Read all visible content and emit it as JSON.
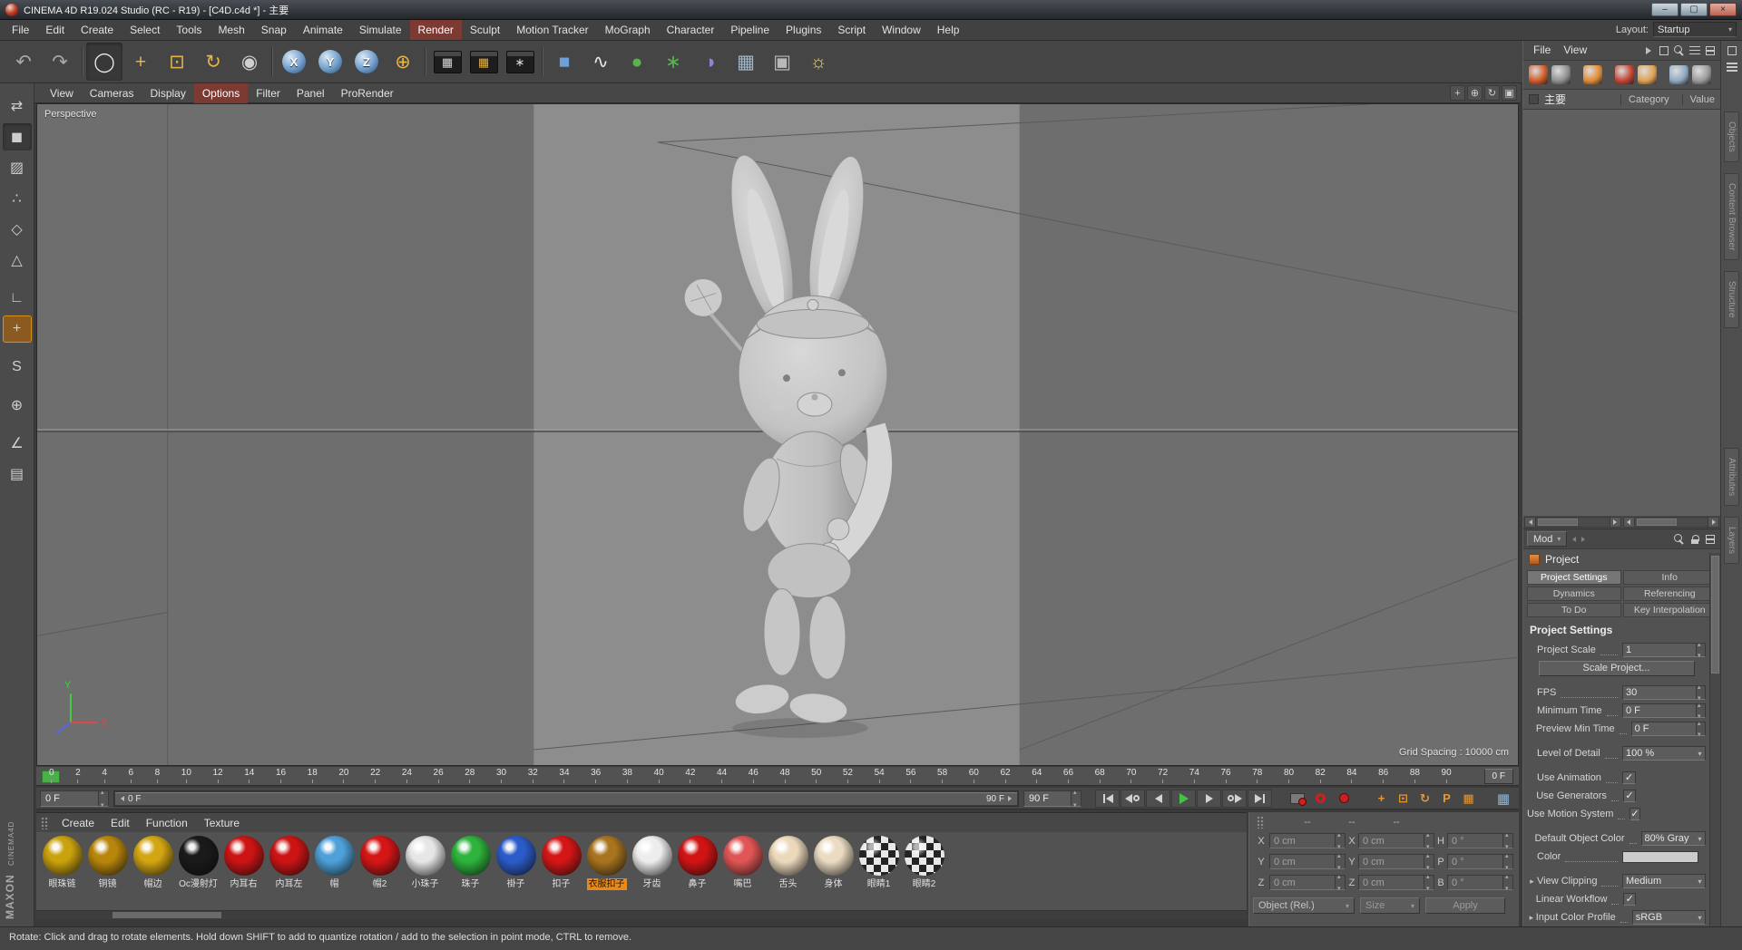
{
  "window": {
    "title": "CINEMA 4D R19.024 Studio (RC - R19) - [C4D.c4d *] - 主要",
    "controls": {
      "minimize": "–",
      "maximize": "▢",
      "close": "×"
    }
  },
  "menu_bar": {
    "items": [
      {
        "label": "File"
      },
      {
        "label": "Edit"
      },
      {
        "label": "Create"
      },
      {
        "label": "Select"
      },
      {
        "label": "Tools"
      },
      {
        "label": "Mesh"
      },
      {
        "label": "Snap"
      },
      {
        "label": "Animate"
      },
      {
        "label": "Simulate"
      },
      {
        "label": "Render",
        "active": true
      },
      {
        "label": "Sculpt"
      },
      {
        "label": "Motion Tracker"
      },
      {
        "label": "MoGraph"
      },
      {
        "label": "Character"
      },
      {
        "label": "Pipeline"
      },
      {
        "label": "Plugins"
      },
      {
        "label": "Script"
      },
      {
        "label": "Window"
      },
      {
        "label": "Help"
      }
    ],
    "layout_label": "Layout:",
    "layout_value": "Startup"
  },
  "toolbar": {
    "buttons": [
      {
        "name": "undo-button",
        "glyph": "↶",
        "color": "#a8a8a8"
      },
      {
        "name": "redo-button",
        "glyph": "↷",
        "color": "#a8a8a8"
      },
      {
        "name": "toolbar-separator",
        "sep": true
      },
      {
        "name": "live-selection-tool",
        "glyph": "◯",
        "color": "#e8e8e8",
        "pressed": true
      },
      {
        "name": "move-tool",
        "glyph": "+",
        "color": "#e3b34c"
      },
      {
        "name": "scale-tool",
        "glyph": "⊡",
        "color": "#e3b34c"
      },
      {
        "name": "rotate-tool",
        "glyph": "↻",
        "color": "#e3b34c"
      },
      {
        "name": "last-used-tool",
        "glyph": "◉",
        "color": "#cfcfcf"
      },
      {
        "name": "toolbar-separator",
        "sep": true
      },
      {
        "name": "x-axis-lock",
        "glyph": "X",
        "color": "#ffffff",
        "round": true
      },
      {
        "name": "y-axis-lock",
        "glyph": "Y",
        "color": "#ffffff",
        "round": true
      },
      {
        "name": "z-axis-lock",
        "glyph": "Z",
        "color": "#ffffff",
        "round": true
      },
      {
        "name": "coordinate-system-toggle",
        "glyph": "⊕",
        "color": "#e3b34c"
      },
      {
        "name": "toolbar-separator",
        "sep": true
      },
      {
        "name": "render-view-button",
        "glyph": "▦",
        "color": "#d8d8d8",
        "dark": true
      },
      {
        "name": "render-picture-viewer-button",
        "glyph": "▦",
        "color": "#e3b34c",
        "dark": true
      },
      {
        "name": "render-settings-button",
        "glyph": "∗",
        "color": "#d8d8d8",
        "dark": true
      },
      {
        "name": "toolbar-separator",
        "sep": true
      },
      {
        "name": "add-primitive-button",
        "glyph": "■",
        "color": "#6f9fd8"
      },
      {
        "name": "add-spline-button",
        "glyph": "∿",
        "color": "#e8e8e8"
      },
      {
        "name": "add-subdivision-surface-button",
        "glyph": "●",
        "color": "#58b34e"
      },
      {
        "name": "add-generator-button",
        "glyph": "∗",
        "color": "#58b34e"
      },
      {
        "name": "add-deformer-button",
        "glyph": "◑",
        "color": "#8f86d8"
      },
      {
        "name": "add-environment-button",
        "glyph": "▦",
        "color": "#9fb6c8"
      },
      {
        "name": "add-camera-button",
        "glyph": "▣",
        "color": "#b8b8b8"
      },
      {
        "name": "add-light-button",
        "glyph": "☼",
        "color": "#e8d87a"
      }
    ]
  },
  "left_toolbar": {
    "buttons": [
      {
        "name": "make-editable-button",
        "glyph": "⇄"
      },
      {
        "name": "model-mode-button",
        "glyph": "◼",
        "pressed": true
      },
      {
        "name": "texture-mode-button",
        "glyph": "▨"
      },
      {
        "name": "points-mode-button",
        "glyph": "∴"
      },
      {
        "name": "edges-mode-button",
        "glyph": "◇"
      },
      {
        "name": "polygons-mode-button",
        "glyph": "△"
      },
      {
        "name": "workplane-mode-button",
        "glyph": "∟",
        "gap": true
      },
      {
        "name": "enable-axis-button",
        "glyph": "+",
        "active": true
      },
      {
        "name": "viewport-solo-button",
        "glyph": "S",
        "gap": true
      },
      {
        "name": "snap-toggle-button",
        "glyph": "⊕",
        "gap": true
      },
      {
        "name": "quantize-button",
        "glyph": "∠",
        "gap": true
      },
      {
        "name": "workplane-lock-button",
        "glyph": "▤"
      }
    ]
  },
  "viewport": {
    "menu": [
      {
        "label": "View"
      },
      {
        "label": "Cameras"
      },
      {
        "label": "Display"
      },
      {
        "label": "Options",
        "active": true
      },
      {
        "label": "Filter"
      },
      {
        "label": "Panel"
      },
      {
        "label": "ProRender"
      }
    ],
    "nav_icons": [
      {
        "name": "pan-view-icon",
        "glyph": "+"
      },
      {
        "name": "zoom-view-icon",
        "glyph": "⊕"
      },
      {
        "name": "rotate-view-icon",
        "glyph": "↻"
      },
      {
        "name": "toggle-panels-icon",
        "glyph": "▣"
      }
    ],
    "camera_label": "Perspective",
    "grid_spacing": "Grid Spacing : 10000 cm",
    "axis_x": "X",
    "axis_y": "Y"
  },
  "timeline": {
    "ticks": [
      0,
      2,
      4,
      6,
      8,
      10,
      12,
      14,
      16,
      18,
      20,
      22,
      24,
      26,
      28,
      30,
      32,
      34,
      36,
      38,
      40,
      42,
      44,
      46,
      48,
      50,
      52,
      54,
      56,
      58,
      60,
      62,
      64,
      66,
      68,
      70,
      72,
      74,
      76,
      78,
      80,
      82,
      84,
      86,
      88,
      90
    ],
    "current_frame": "0 F",
    "frame_field": "0 F",
    "range_start": "0 F",
    "range_end": "90 F",
    "end_field": "90 F",
    "window_icon": "▦",
    "toggles": [
      {
        "name": "record-position-toggle",
        "glyph": "+"
      },
      {
        "name": "record-scale-toggle",
        "glyph": "⊡"
      },
      {
        "name": "record-rotation-toggle",
        "glyph": "↻"
      },
      {
        "name": "record-parameter-toggle",
        "glyph": "P"
      },
      {
        "name": "record-pla-toggle",
        "glyph": "▦"
      }
    ]
  },
  "materials": {
    "menus": [
      {
        "label": "Create"
      },
      {
        "label": "Edit"
      },
      {
        "label": "Function"
      },
      {
        "label": "Texture"
      }
    ],
    "items": [
      {
        "label": "眼珠链",
        "color": "#caa20e"
      },
      {
        "label": "铜镜",
        "color": "#b8860b"
      },
      {
        "label": "帽边",
        "color": "#d2a612"
      },
      {
        "label": "Oc漫射灯",
        "color": "#1a1a1a"
      },
      {
        "label": "内耳右",
        "color": "#cc1414"
      },
      {
        "label": "内耳左",
        "color": "#cc1414"
      },
      {
        "label": "帽",
        "color": "#4da0d8"
      },
      {
        "label": "帽2",
        "color": "#d41616"
      },
      {
        "label": "小珠子",
        "color": "#e6e6e6"
      },
      {
        "label": "珠子",
        "color": "#2eb33c"
      },
      {
        "label": "褂子",
        "color": "#2b5bc8"
      },
      {
        "label": "扣子",
        "color": "#d41616"
      },
      {
        "label": "衣服扣子",
        "color": "#a9741f",
        "selected": true
      },
      {
        "label": "牙齿",
        "color": "#ededed"
      },
      {
        "label": "鼻子",
        "color": "#d01414"
      },
      {
        "label": "嘴巴",
        "color": "#e05555"
      },
      {
        "label": "舌头",
        "color": "#ecd9bc"
      },
      {
        "label": "身体",
        "color": "#eadbc2"
      },
      {
        "label": "眼睛1",
        "color": "#cccccc",
        "checker": true
      },
      {
        "label": "眼睛2",
        "color": "#cccccc",
        "checker": true
      }
    ]
  },
  "coordinates": {
    "headers": [
      "--",
      "--",
      "--"
    ],
    "rows": [
      {
        "pl": "X",
        "pv": "0 cm",
        "sl": "X",
        "sv": "0 cm",
        "rl": "H",
        "rv": "0 °"
      },
      {
        "pl": "Y",
        "pv": "0 cm",
        "sl": "Y",
        "sv": "0 cm",
        "rl": "P",
        "rv": "0 °"
      },
      {
        "pl": "Z",
        "pv": "0 cm",
        "sl": "Z",
        "sv": "0 cm",
        "rl": "B",
        "rv": "0 °"
      }
    ],
    "mode": "Object (Rel.)",
    "size_mode": "Size",
    "apply_label": "Apply"
  },
  "take_panel": {
    "menus": [
      {
        "label": "File"
      },
      {
        "label": "View"
      }
    ],
    "icons": [
      {
        "name": "take-record-icon",
        "c": "#d05a28"
      },
      {
        "name": "take-lock-icon",
        "c": "#8f8f8f"
      },
      {
        "name": "auto-take-icon",
        "c": "#e08a30",
        "gap": true
      },
      {
        "name": "new-take-icon",
        "c": "#c24432",
        "gap": true
      },
      {
        "name": "take-category-icon",
        "c": "#e0a050"
      },
      {
        "name": "take-display-icon",
        "c": "#90a8c0",
        "gap": true
      },
      {
        "name": "take-overrides-icon",
        "c": "#9a9a9a"
      }
    ],
    "main_take": "主要",
    "columns": [
      "Category",
      "Value"
    ]
  },
  "attributes": {
    "mode_label": "Mod",
    "object_label": "Project",
    "tabs": [
      {
        "label": "Project Settings",
        "active": true
      },
      {
        "label": "Info"
      },
      {
        "label": "Dynamics"
      },
      {
        "label": "Referencing"
      },
      {
        "label": "To Do"
      },
      {
        "label": "Key Interpolation"
      }
    ],
    "section_title": "Project Settings",
    "fields": [
      {
        "label": "Project Scale",
        "value": "1",
        "kind": "input"
      },
      {
        "value": "Scale Project...",
        "kind": "button"
      },
      {
        "label": "FPS",
        "value": "30",
        "kind": "input",
        "gap": true
      },
      {
        "label": "Minimum Time",
        "value": "0 F",
        "kind": "input"
      },
      {
        "label": "Preview Min Time",
        "value": "0 F",
        "kind": "input"
      },
      {
        "label": "Level of Detail",
        "value": "100 %",
        "kind": "select",
        "gap": true
      },
      {
        "label": "Use Animation",
        "checked": "✓",
        "kind": "check",
        "gap": true
      },
      {
        "label": "Use Generators",
        "checked": "✓",
        "kind": "check"
      },
      {
        "label": "Use Motion System",
        "checked": "✓",
        "kind": "check"
      },
      {
        "label": "Default Object Color",
        "value": "80% Gray",
        "kind": "select",
        "gap": true
      },
      {
        "label": "Color",
        "kind": "color",
        "swatch": "#cccccc"
      },
      {
        "label": "View Clipping",
        "value": "Medium",
        "kind": "select",
        "expand": "▸",
        "gap": true
      },
      {
        "label": "Linear Workflow",
        "checked": "✓",
        "kind": "check"
      },
      {
        "label": "Input Color Profile",
        "value": "sRGB",
        "kind": "select",
        "expand": "▸"
      }
    ]
  },
  "side_tabs": {
    "top": [
      {
        "label": "Objects"
      },
      {
        "label": "Content Browser"
      },
      {
        "label": "Structure"
      }
    ],
    "bottom": [
      {
        "label": "Attributes"
      },
      {
        "label": "Layers"
      }
    ]
  },
  "status_bar": {
    "text": "Rotate: Click and drag to rotate elements. Hold down SHIFT to add to quantize rotation / add to the selection in point mode, CTRL to remove."
  },
  "branding": {
    "line1": "MAXON",
    "line2": "CINEMA4D"
  }
}
